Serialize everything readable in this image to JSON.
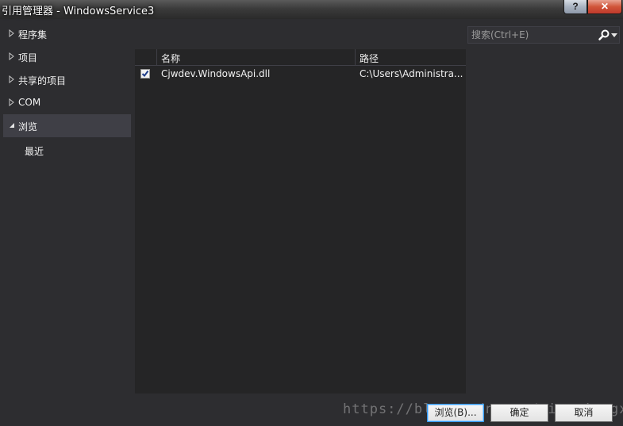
{
  "window": {
    "title": "引用管理器 - WindowsService3",
    "help_label": "?",
    "close_label": "✕"
  },
  "nav": {
    "items": [
      {
        "label": "程序集",
        "expanded": false,
        "selected": false
      },
      {
        "label": "项目",
        "expanded": false,
        "selected": false
      },
      {
        "label": "共享的项目",
        "expanded": false,
        "selected": false
      },
      {
        "label": "COM",
        "expanded": false,
        "selected": false
      },
      {
        "label": "浏览",
        "expanded": true,
        "selected": true
      }
    ],
    "sub_items": [
      "最近"
    ]
  },
  "list": {
    "columns": [
      "名称",
      "路径"
    ],
    "rows": [
      {
        "checked": true,
        "name": "Cjwdev.WindowsApi.dll",
        "path": "C:\\Users\\Administra..."
      }
    ]
  },
  "search": {
    "placeholder": "搜索(Ctrl+E)",
    "value": ""
  },
  "footer": {
    "browse_label": "浏览(B)...",
    "ok_label": "确定",
    "cancel_label": "取消"
  },
  "watermark": "https://blog.csdn.net/qingxiangxie"
}
